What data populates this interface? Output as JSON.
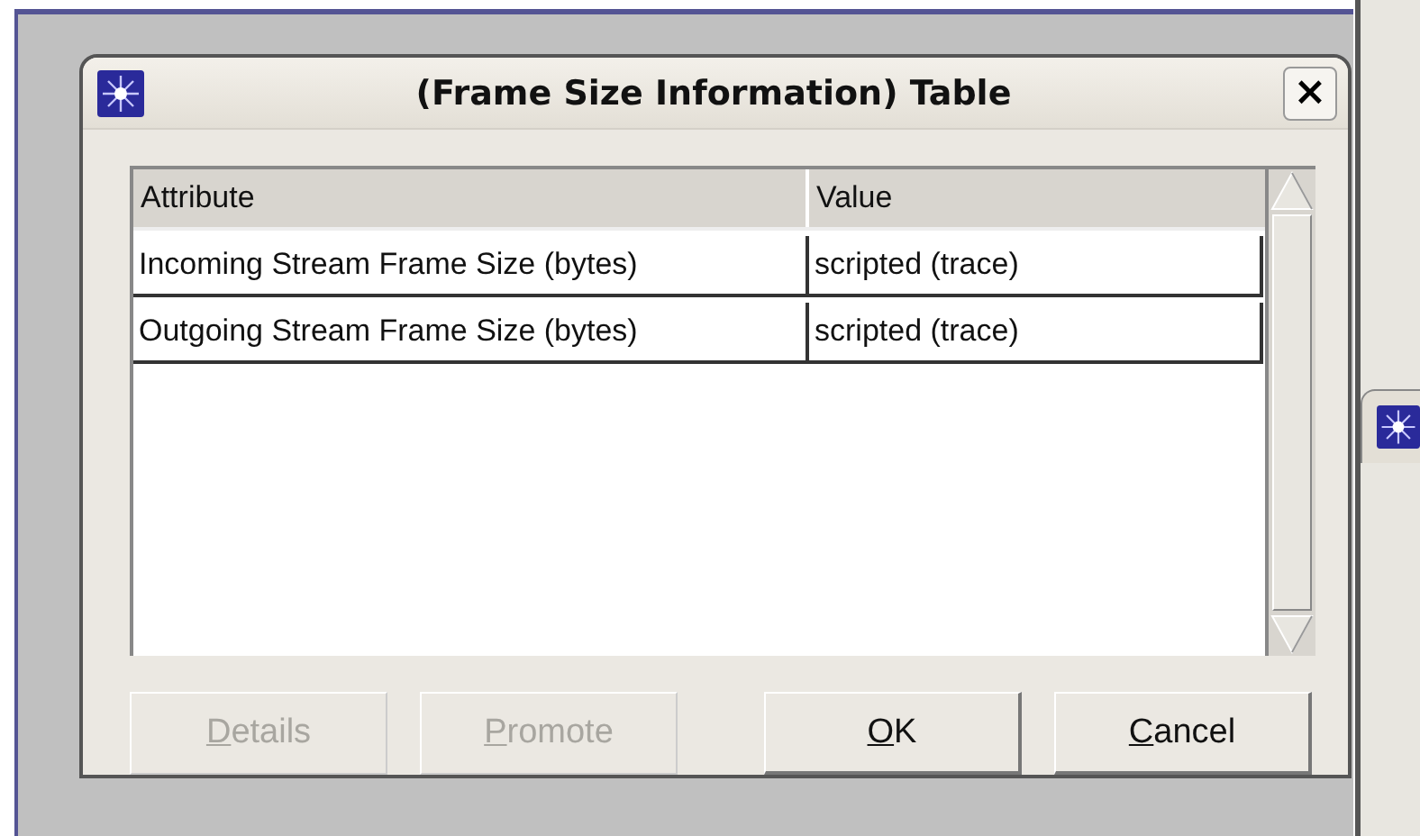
{
  "dialog": {
    "title": "(Frame Size Information) Table",
    "close": "×"
  },
  "table": {
    "columns": [
      "Attribute",
      "Value"
    ],
    "rows": [
      {
        "cells": [
          "Incoming Stream Frame Size (bytes)",
          "scripted (trace)"
        ]
      },
      {
        "cells": [
          "Outgoing Stream Frame Size (bytes)",
          "scripted (trace)"
        ]
      }
    ]
  },
  "buttons": [
    {
      "label": "Details",
      "disabled": true
    },
    {
      "label": "Promote",
      "disabled": true
    },
    {
      "label": "OK",
      "disabled": false
    },
    {
      "label": "Cancel",
      "disabled": false
    }
  ]
}
